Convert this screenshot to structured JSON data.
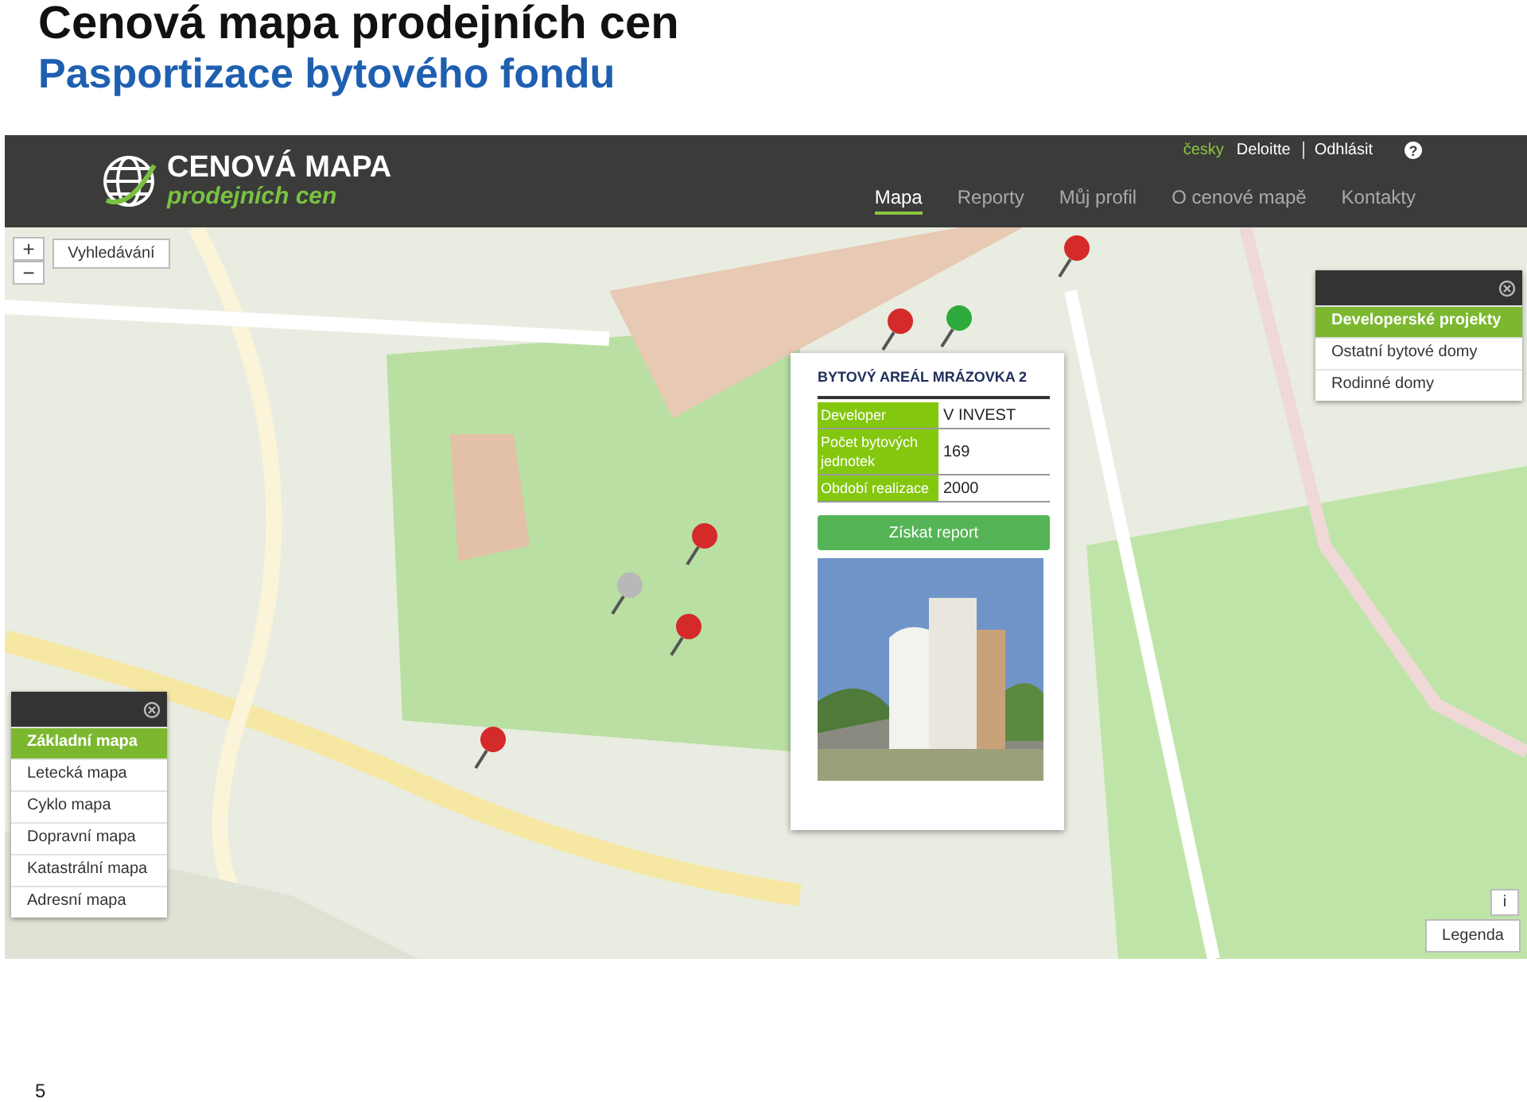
{
  "slide": {
    "title": "Cenová mapa prodejních cen",
    "subtitle": "Pasportizace bytového fondu",
    "page_number": "5"
  },
  "header": {
    "logo_title": "CENOVÁ MAPA",
    "logo_subtitle": "prodejních cen",
    "top_links": [
      {
        "label": "česky",
        "selected": true
      },
      {
        "label": "Deloitte",
        "selected": false
      },
      {
        "label": "Odhlásit",
        "selected": false
      }
    ],
    "help": "?",
    "nav": [
      {
        "label": "Mapa",
        "selected": true
      },
      {
        "label": "Reporty",
        "selected": false
      },
      {
        "label": "Můj profil",
        "selected": false
      },
      {
        "label": "O cenové mapě",
        "selected": false
      },
      {
        "label": "Kontakty",
        "selected": false
      }
    ]
  },
  "map": {
    "zoom_in": "+",
    "zoom_out": "−",
    "search_button": "Vyhledávání",
    "pins": [
      {
        "color": "#d42a2a"
      },
      {
        "color": "#2eaa3c"
      },
      {
        "color": "#d42a2a"
      },
      {
        "color": "#d42a2a"
      },
      {
        "color": "#b8b8b8"
      },
      {
        "color": "#d42a2a"
      },
      {
        "color": "#d42a2a"
      }
    ],
    "layer_panel": {
      "items": [
        {
          "label": "Základní mapa",
          "selected": true
        },
        {
          "label": "Letecká mapa",
          "selected": false
        },
        {
          "label": "Cyklo mapa",
          "selected": false
        },
        {
          "label": "Dopravní mapa",
          "selected": false
        },
        {
          "label": "Katastrální mapa",
          "selected": false
        },
        {
          "label": "Adresní mapa",
          "selected": false
        }
      ]
    },
    "category_panel": {
      "items": [
        {
          "label": "Developerské projekty",
          "selected": true
        },
        {
          "label": "Ostatní bytové domy",
          "selected": false
        },
        {
          "label": "Rodinné domy",
          "selected": false
        }
      ]
    },
    "info_button": "i",
    "legend_button": "Legenda",
    "popup": {
      "title": "BYTOVÝ AREÁL MRÁZOVKA 2",
      "rows": [
        {
          "label": "Developer",
          "value": "V INVEST"
        },
        {
          "label": "Počet bytových jednotek",
          "value": "169"
        },
        {
          "label": "Období realizace",
          "value": "2000"
        }
      ],
      "button": "Získat report"
    }
  }
}
